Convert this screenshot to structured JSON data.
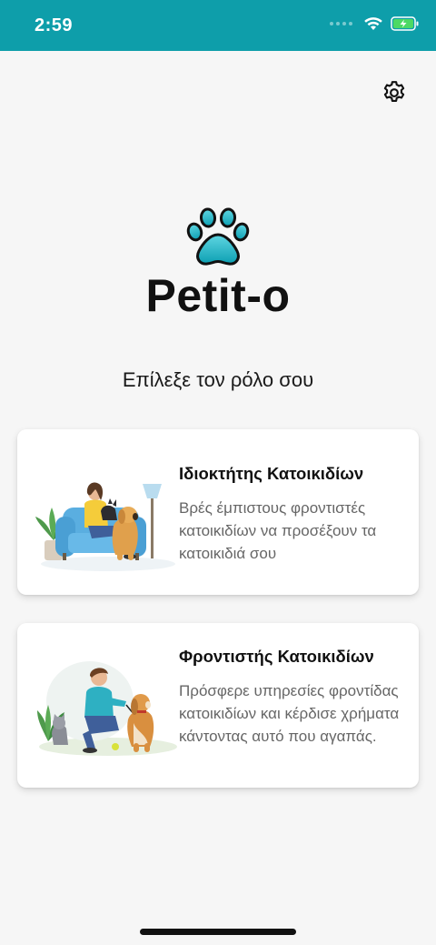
{
  "status_bar": {
    "time": "2:59",
    "background": "#0e9eaa"
  },
  "header": {
    "settings_icon": "gear-icon"
  },
  "brand": {
    "name": "Petit-o",
    "logo_icon": "paw-icon",
    "accent": "#19b7c8"
  },
  "prompt": "Επίλεξε τον ρόλο σου",
  "roles": [
    {
      "title": "Ιδιοκτήτης Κατοικιδίων",
      "description": "Βρές έμπιστους φροντιστές κατοικιδίων να προσέξουν τα κατοικιδιά σου",
      "illustration": "owner-with-pets-illustration"
    },
    {
      "title": "Φροντιστής Κατοικιδίων",
      "description": "Πρόσφερε υπηρεσίες φροντίδας κατοικιδίων και κέρδισε χρήματα κάντοντας αυτό που αγαπάς.",
      "illustration": "sitter-with-pets-illustration"
    }
  ]
}
